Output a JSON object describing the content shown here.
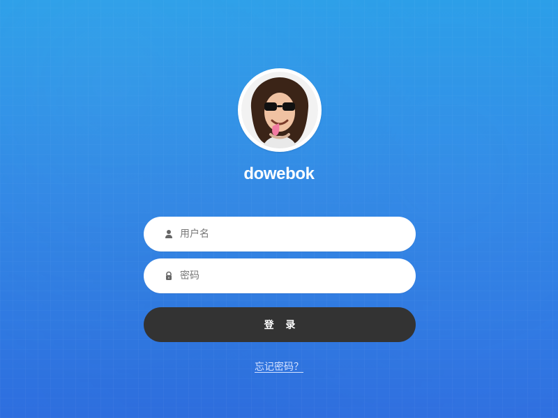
{
  "brand": {
    "name": "dowebok"
  },
  "avatar": {
    "alt": "user avatar"
  },
  "form": {
    "username": {
      "placeholder": "用户名",
      "icon": "user-icon"
    },
    "password": {
      "placeholder": "密码",
      "icon": "lock-icon"
    },
    "login_label": "登 录",
    "forgot_label": "忘记密码？"
  },
  "colors": {
    "background_top": "#2a9ee8",
    "background_bottom": "#2f6fe0",
    "field_bg": "#ffffff",
    "button_bg": "#333333",
    "link": "#d7e3ff"
  }
}
